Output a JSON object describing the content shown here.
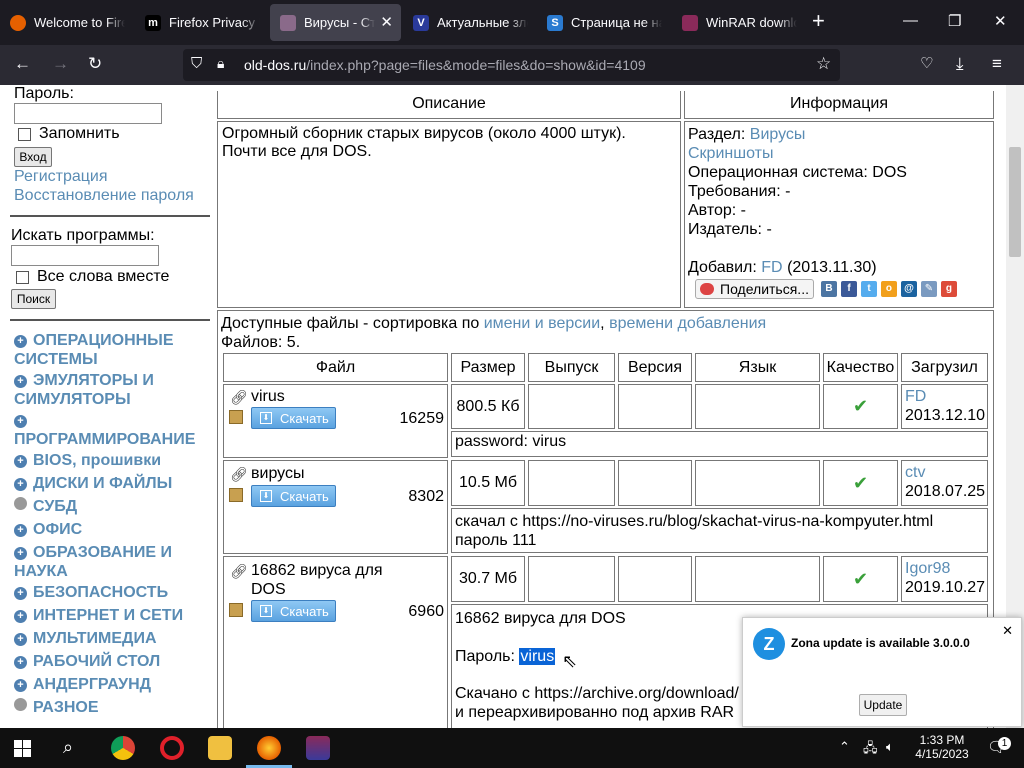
{
  "browser": {
    "tabs": [
      {
        "title": "Welcome to Firefox",
        "active": false
      },
      {
        "title": "Firefox Privacy N",
        "active": false
      },
      {
        "title": "Вирусы - Стар",
        "active": true
      },
      {
        "title": "Актуальные зло",
        "active": false
      },
      {
        "title": "Страница не най",
        "active": false
      },
      {
        "title": "WinRAR downlo",
        "active": false
      }
    ],
    "url_host": "old-dos.ru",
    "url_path": "/index.php?page=files&mode=files&do=show&id=4109"
  },
  "sidebar": {
    "password_label": "Пароль:",
    "remember_label": "Запомнить",
    "login_button": "Вход",
    "register_link": "Регистрация",
    "restore_link": "Восстановление пароля",
    "search_label": "Искать программы:",
    "all_words_label": "Все слова вместе",
    "search_button": "Поиск",
    "categories": [
      {
        "label": "ОПЕРАЦИОННЫЕ СИСТЕМЫ",
        "expandable": true
      },
      {
        "label": "ЭМУЛЯТОРЫ И СИМУЛЯТОРЫ",
        "expandable": true
      },
      {
        "label": "ПРОГРАММИРОВАНИЕ",
        "expandable": true
      },
      {
        "label": "BIOS, прошивки",
        "expandable": true
      },
      {
        "label": "ДИСКИ И ФАЙЛЫ",
        "expandable": true
      },
      {
        "label": "СУБД",
        "expandable": false
      },
      {
        "label": "ОФИС",
        "expandable": true
      },
      {
        "label": "ОБРАЗОВАНИЕ И НАУКА",
        "expandable": true
      },
      {
        "label": "БЕЗОПАСНОСТЬ",
        "expandable": true
      },
      {
        "label": "ИНТЕРНЕТ И СЕТИ",
        "expandable": true
      },
      {
        "label": "МУЛЬТИМЕДИА",
        "expandable": true
      },
      {
        "label": "РАБОЧИЙ СТОЛ",
        "expandable": true
      },
      {
        "label": "АНДЕРГРАУНД",
        "expandable": true
      },
      {
        "label": "РАЗНОЕ",
        "expandable": false
      }
    ]
  },
  "main": {
    "description_header": "Описание",
    "info_header": "Информация",
    "description_line1": "Огромный сборник старых вирусов (около 4000 штук).",
    "description_line2": "Почти все для DOS.",
    "info": {
      "section_label": "Раздел:",
      "section_value": "Вирусы",
      "screenshots_link": "Скриншоты",
      "os_line": "Операционная система: DOS",
      "requirements_line": "Требования: -",
      "author_line": "Автор: -",
      "publisher_line": "Издатель: -",
      "added_label": "Добавил:",
      "added_user": "FD",
      "added_date": "(2013.11.30)",
      "share_button": "Поделиться..."
    },
    "files_intro": "Доступные файлы - сортировка по",
    "sort_name_link": "имени и версии",
    "sort_sep": ",",
    "sort_time_link": "времени добавления",
    "files_count": "Файлов: 5.",
    "table_headers": [
      "Файл",
      "Размер",
      "Выпуск",
      "Версия",
      "Язык",
      "Качество",
      "Загрузил"
    ],
    "download_label": "Скачать",
    "files": [
      {
        "name": "virus",
        "downloads": "16259",
        "size": "800.5 Кб",
        "uploader": "FD",
        "date": "2013.12.10",
        "note": "password: virus"
      },
      {
        "name": "вирусы",
        "downloads": "8302",
        "size": "10.5 Мб",
        "uploader": "ctv",
        "date": "2018.07.25",
        "note_line1": "скачал с https://no-viruses.ru/blog/skachat-virus-na-kompyuter.html",
        "note_line2": "пароль 111"
      },
      {
        "name_line1": "16862 вируса для",
        "name_line2": "DOS",
        "downloads": "6960",
        "size": "30.7 Мб",
        "uploader": "Igor98",
        "date": "2019.10.27",
        "note_line1": "16862 вируса для DOS",
        "note_pw_label": "Пароль:",
        "note_pw_value": "virus",
        "note_line3": "Скачано с https://archive.org/download/",
        "note_line4": "и переархивированно под архив RAR"
      }
    ]
  },
  "notification": {
    "title": "Zona update is available 3.0.0.0",
    "button": "Update"
  },
  "taskbar": {
    "time": "1:33 PM",
    "date": "4/15/2023",
    "notif_count": "1"
  }
}
